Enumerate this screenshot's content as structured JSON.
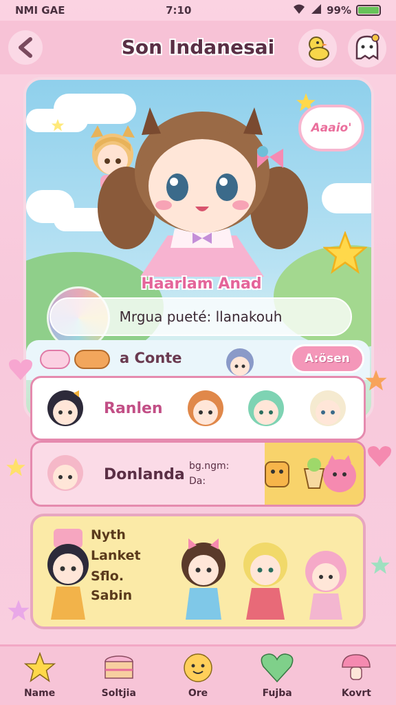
{
  "status_bar": {
    "carrier": "NMI GAE",
    "time": "7:10",
    "battery": "99%",
    "battery_level": 0.99
  },
  "header": {
    "title": "Son Indanesai",
    "back_icon": "chevron-left-icon",
    "right_icons": [
      "duck-icon",
      "ghost-icon"
    ]
  },
  "hero": {
    "speech_bubble": "Aaaio'",
    "character_name": "Haarlam Anad",
    "subtitle": "Mrgua pueté: llanakouh"
  },
  "contest": {
    "label": "a Conte",
    "action_label": "A:ösen"
  },
  "rows": [
    {
      "label": "Ranlen"
    },
    {
      "label": "Donlanda",
      "side_text_1": "bg.ngm:",
      "side_text_2": "Da:"
    }
  ],
  "yellow_card": {
    "lines": [
      "Nyth",
      "Lanket",
      "Sflo.",
      "Sabin"
    ]
  },
  "bottom_nav": {
    "items": [
      {
        "label": "Name",
        "icon": "star-icon"
      },
      {
        "label": "Soltjia",
        "icon": "cake-icon"
      },
      {
        "label": "Ore",
        "icon": "smiley-icon"
      },
      {
        "label": "Fujba",
        "icon": "heart-icon"
      },
      {
        "label": "Kovrt",
        "icon": "mushroom-icon"
      }
    ]
  },
  "colors": {
    "background": "#f8c8db",
    "accent_pink": "#f497b9",
    "yellow_card": "#fbeaa7",
    "sky": "#8fd0ec"
  }
}
